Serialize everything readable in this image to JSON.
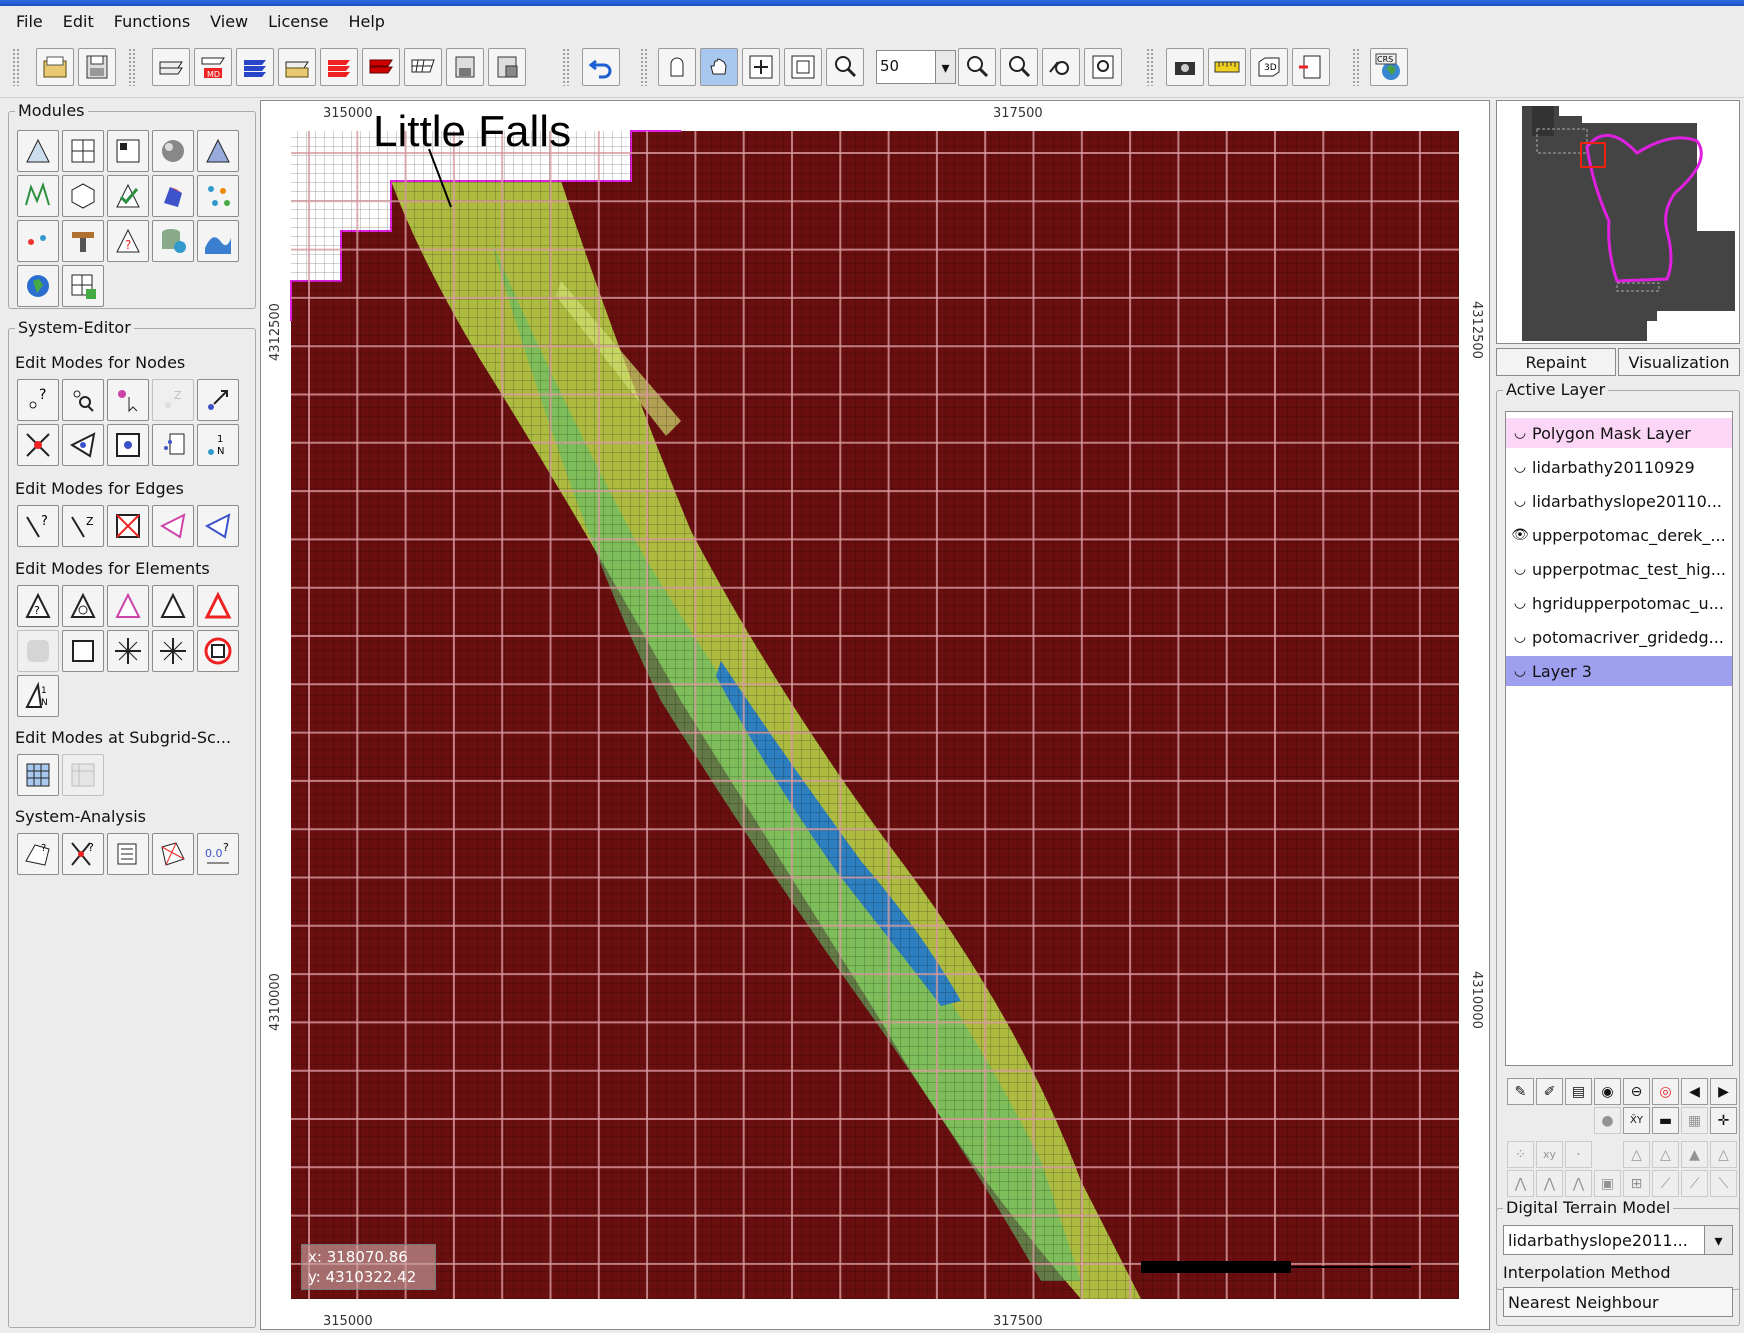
{
  "menu": [
    "File",
    "Edit",
    "Functions",
    "View",
    "License",
    "Help"
  ],
  "toolbar": {
    "zoom_value": "50"
  },
  "left_panel": {
    "modules_title": "Modules",
    "system_editor_title": "System-Editor",
    "edit_nodes": "Edit Modes for Nodes",
    "edit_edges": "Edit Modes for Edges",
    "edit_elements": "Edit Modes for Elements",
    "edit_subgrid": "Edit Modes at Subgrid-Sc...",
    "system_analysis_title": "System-Analysis"
  },
  "map": {
    "annotation": "Little Falls",
    "x_ticks": [
      "315000",
      "317500"
    ],
    "y_ticks": [
      "4312500",
      "4310000"
    ],
    "coord_x": "x: 318070.86",
    "coord_y": "y: 4310322.42",
    "colors": {
      "background": "#6a0f0f",
      "grid_line": "#d89aa0",
      "river_outer": "#b8d94a",
      "river_inner": "#2e7fbf",
      "mask_line": "#e020e0"
    }
  },
  "right_panel": {
    "repaint": "Repaint",
    "visualization": "Visualization",
    "active_layer_title": "Active Layer",
    "layers": [
      {
        "label": "Polygon Mask Layer",
        "icon": "hidden-eye-icon",
        "state": "pink"
      },
      {
        "label": "lidarbathy20110929",
        "icon": "hidden-eye-icon",
        "state": ""
      },
      {
        "label": "lidarbathyslope20110...",
        "icon": "hidden-eye-icon",
        "state": ""
      },
      {
        "label": "upperpotomac_derek_...",
        "icon": "visible-eye-icon",
        "state": ""
      },
      {
        "label": "upperpotmac_test_hig...",
        "icon": "hidden-eye-icon",
        "state": ""
      },
      {
        "label": "hgridupperpotomac_u...",
        "icon": "hidden-eye-icon",
        "state": ""
      },
      {
        "label": "potomacriver_gridedg...",
        "icon": "hidden-eye-icon",
        "state": ""
      },
      {
        "label": "Layer 3",
        "icon": "hidden-eye-icon",
        "state": "sel"
      }
    ],
    "dtm_title": "Digital Terrain Model",
    "dtm_value": "lidarbathyslope2011...",
    "interp_label": "Interpolation Method",
    "interp_value": "Nearest Neighbour"
  }
}
